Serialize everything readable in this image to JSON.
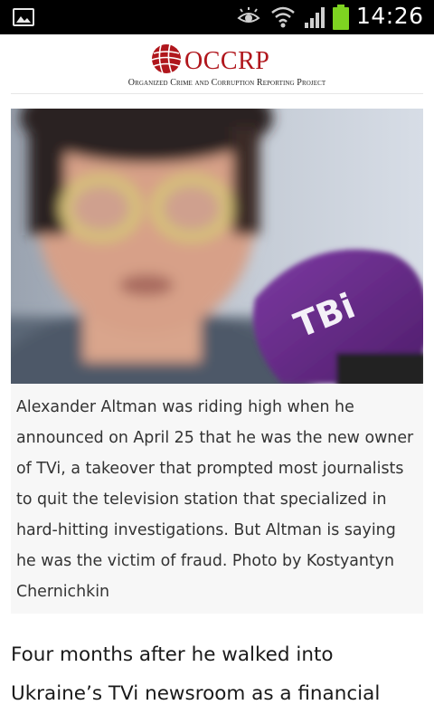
{
  "status_bar": {
    "time": "14:26",
    "icons": [
      "gallery-icon",
      "eye-icon",
      "wifi-icon",
      "signal-icon",
      "battery-icon"
    ],
    "battery_color": "#7ed321"
  },
  "header": {
    "logo_text": "OCCRP",
    "tagline": "Organized Crime and Corruption Reporting Project",
    "brand_color": "#b0161c"
  },
  "photo": {
    "microphone_text": "TBi",
    "microphone_color": "#6a2a8c"
  },
  "caption": {
    "text": "Alexander Altman was riding high when he announced on April 25 that he was the new owner of TVi, a takeover that prompted most journalists to quit the television station that specialized in hard-hitting investigations. But Altman is saying he was the victim of fraud. Photo by Kostyantyn Chernichkin"
  },
  "article": {
    "lead": "Four months after he walked into Ukraine’s TVi newsroom as a financial"
  }
}
